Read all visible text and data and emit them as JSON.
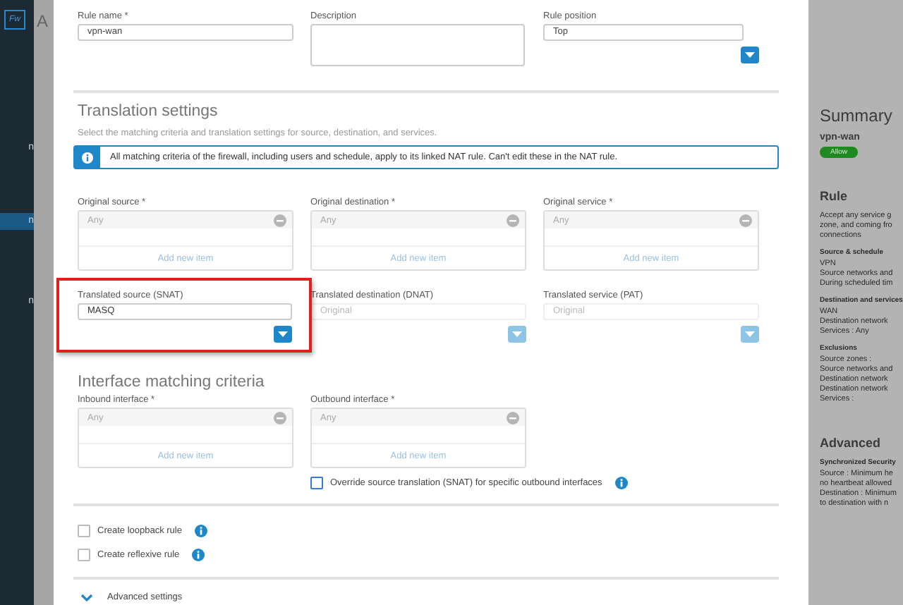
{
  "sidebar": {
    "logo": "Fw",
    "items": [
      {
        "label": "n",
        "selected": false
      },
      {
        "label": "n",
        "selected": true
      },
      {
        "label": "n",
        "selected": false
      }
    ]
  },
  "back_title": "A",
  "rule_name": {
    "label": "Rule name *",
    "value": "vpn-wan"
  },
  "description": {
    "label": "Description"
  },
  "rule_position": {
    "label": "Rule position",
    "value": "Top"
  },
  "translation": {
    "title": "Translation settings",
    "subtitle": "Select the matching criteria and translation settings for source, destination, and services.",
    "info": "All matching criteria of the firewall, including users and schedule, apply to its linked NAT rule. Can't edit these in the NAT rule.",
    "original": [
      {
        "label": "Original source *",
        "value": "Any",
        "add": "Add new item"
      },
      {
        "label": "Original destination *",
        "value": "Any",
        "add": "Add new item"
      },
      {
        "label": "Original service *",
        "value": "Any",
        "add": "Add new item"
      }
    ],
    "translated": [
      {
        "label": "Translated source (SNAT)",
        "value": "MASQ",
        "disabled": false,
        "highlighted": true
      },
      {
        "label": "Translated destination (DNAT)",
        "placeholder": "Original",
        "disabled": true,
        "highlighted": false
      },
      {
        "label": "Translated service (PAT)",
        "placeholder": "Original",
        "disabled": true,
        "highlighted": false
      }
    ]
  },
  "interface": {
    "title": "Interface matching criteria",
    "fields": [
      {
        "label": "Inbound interface *",
        "value": "Any",
        "add": "Add new item"
      },
      {
        "label": "Outbound interface *",
        "value": "Any",
        "add": "Add new item"
      }
    ],
    "override": {
      "label": "Override source translation (SNAT) for specific outbound interfaces",
      "checked": false
    }
  },
  "options": [
    {
      "label": "Create loopback rule",
      "checked": false
    },
    {
      "label": "Create reflexive rule",
      "checked": false
    }
  ],
  "advanced": {
    "label": "Advanced settings",
    "expanded": false
  },
  "summary": {
    "title": "Summary",
    "name": "vpn-wan",
    "badge": "Allow",
    "sections": [
      {
        "heading": "Rule",
        "kind": "heading",
        "lines": [
          "Accept any service g",
          "zone, and coming fro",
          "connections"
        ]
      },
      {
        "heading": "Source & schedule",
        "kind": "sub",
        "lines": [
          "VPN",
          "Source networks and",
          "During scheduled tim"
        ]
      },
      {
        "heading": "Destination and services",
        "kind": "sub",
        "lines": [
          "WAN",
          "Destination network",
          "Services : Any"
        ]
      },
      {
        "heading": "Exclusions",
        "kind": "sub",
        "lines": [
          "Source zones :",
          "Source networks and",
          "Destination network",
          "Destination network",
          "Services :"
        ]
      },
      {
        "heading": "Advanced",
        "kind": "heading"
      },
      {
        "heading": "Synchronized Security",
        "kind": "sub",
        "lines": [
          "Source : Minimum he",
          "no heartbeat allowed",
          "Destination : Minimum",
          "to destination with n"
        ]
      }
    ]
  }
}
